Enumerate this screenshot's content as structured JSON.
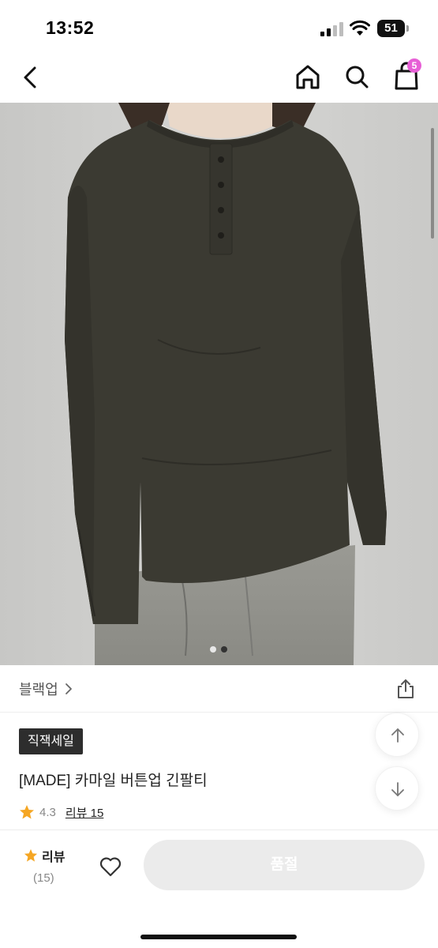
{
  "status_bar": {
    "time": "13:52",
    "battery": "51",
    "icons": [
      "signal-icon",
      "wifi-icon",
      "battery-icon"
    ]
  },
  "header": {
    "icons": [
      "back-icon",
      "home-icon",
      "search-icon",
      "cart-icon"
    ],
    "cart_count": "5",
    "badge_color": "#e75fd6"
  },
  "gallery": {
    "dots_total": 2,
    "active_dot": 2
  },
  "category": {
    "label": "블랙업",
    "chevron": "›"
  },
  "product": {
    "badge": "직잭세일",
    "title": "[MADE] 카마일 버튼업 긴팔티",
    "rating": "4.3",
    "review_link": "리뷰 15"
  },
  "bottom_bar": {
    "review_label": "리뷰",
    "review_count": "(15)",
    "soldout_label": "품절"
  },
  "colors": {
    "accent_star": "#f5a623",
    "shirt": "#3b3a32",
    "badge_bg": "#2d2d2d"
  }
}
